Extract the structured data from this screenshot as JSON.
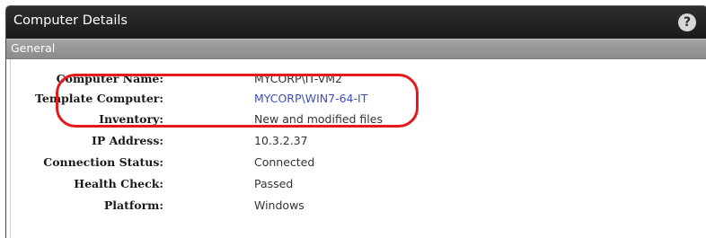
{
  "panel": {
    "title": "Computer Details",
    "help_icon": "?"
  },
  "section": {
    "title": "General"
  },
  "details": [
    {
      "label": "Computer Name:",
      "value": "MYCORP\\IT-VM2"
    },
    {
      "label": "Template Computer:",
      "value": "MYCORP\\WIN7-64-IT"
    },
    {
      "label": "Inventory:",
      "value": "New and modified files"
    },
    {
      "label": "IP Address:",
      "value": "10.3.2.37"
    },
    {
      "label": "Connection Status:",
      "value": "Connected"
    },
    {
      "label": "Health Check:",
      "value": "Passed"
    },
    {
      "label": "Platform:",
      "value": "Windows"
    }
  ],
  "colors": {
    "highlight": "#e11b1b",
    "link": "#3d4fc0",
    "titlebar": "#222222",
    "sectionbar": "#999999"
  }
}
